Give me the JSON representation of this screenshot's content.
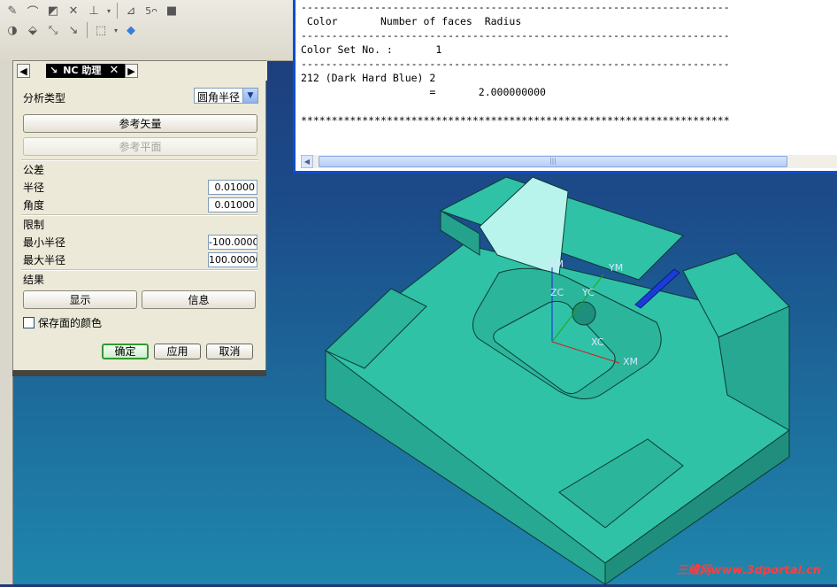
{
  "toolbar": {
    "row1_icons": [
      "sketch-icon",
      "curve-icon",
      "feature-icon",
      "trim-icon",
      "transform-icon",
      "dropdown-arrow-icon",
      "section-icon",
      "units-icon",
      "solid-icon"
    ],
    "row2_icons": [
      "rotate-icon",
      "render-icon",
      "pan-icon",
      "select-box-icon",
      "dropdown-arrow-icon",
      "shaded-cube-icon"
    ]
  },
  "panel": {
    "title": "NC 助理",
    "analysis_type_label": "分析类型",
    "analysis_type_value": "圆角半径",
    "reference_vector_button": "参考矢量",
    "reference_plane_button": "参考平面",
    "tolerance_header": "公差",
    "radius_label": "半径",
    "radius_value": "0.01000",
    "angle_label": "角度",
    "angle_value": "0.01000",
    "limits_header": "限制",
    "min_radius_label": "最小半径",
    "min_radius_value": "-100.0000",
    "max_radius_label": "最大半径",
    "max_radius_value": "100.00000",
    "results_header": "结果",
    "display_button": "显示",
    "info_button": "信息",
    "save_face_color_label": "保存面的颜色",
    "save_face_color_checked": false,
    "ok_button": "确定",
    "apply_button": "应用",
    "cancel_button": "取消"
  },
  "info_window": {
    "lines": [
      "----------------------------------------------------------------------",
      " Color       Number of faces  Radius",
      "----------------------------------------------------------------------",
      "Color Set No. :       1",
      "----------------------------------------------------------------------",
      "212 (Dark Hard Blue) 2",
      "                     =       2.000000000",
      "",
      "**********************************************************************"
    ]
  },
  "viewport": {
    "background_top": "#1e3a78",
    "background_bottom": "#1f86ac",
    "part_color": "#2fc2a6",
    "highlight_color": "#1a3cd8",
    "axis_labels": [
      "ZM",
      "YM",
      "ZC",
      "YC",
      "XC",
      "XM"
    ],
    "watermark": "三维网www.3dportal.cn"
  }
}
